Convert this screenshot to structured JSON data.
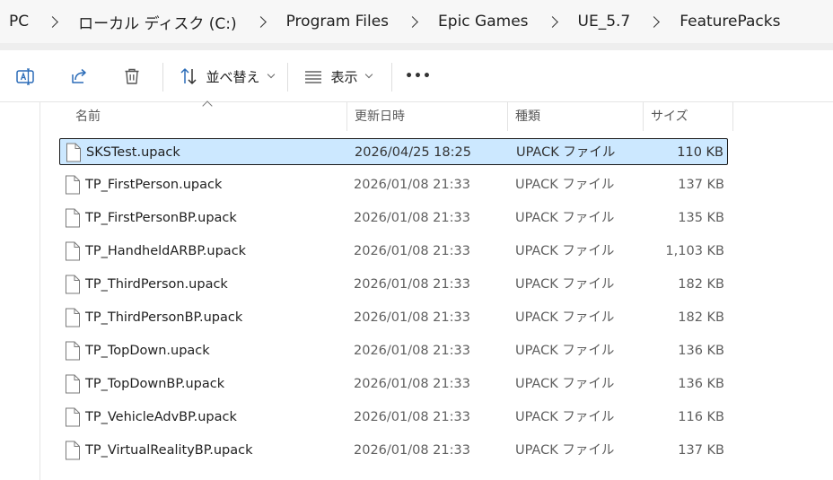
{
  "breadcrumb": [
    "PC",
    "ローカル ディスク (C:)",
    "Program Files",
    "Epic Games",
    "UE_5.7",
    "FeaturePacks"
  ],
  "toolbar": {
    "rename_icon": "rename-icon",
    "share_icon": "share-icon",
    "delete_icon": "trash-icon",
    "sort_label": "並べ替え",
    "view_label": "表示",
    "more_label": "•••"
  },
  "columns": {
    "name": "名前",
    "date": "更新日時",
    "type": "種類",
    "size": "サイズ"
  },
  "files": [
    {
      "name": "SKSTest.upack",
      "date": "2026/04/25 18:25",
      "type": "UPACK ファイル",
      "size": "110 KB",
      "selected": true
    },
    {
      "name": "TP_FirstPerson.upack",
      "date": "2026/01/08 21:33",
      "type": "UPACK ファイル",
      "size": "137 KB"
    },
    {
      "name": "TP_FirstPersonBP.upack",
      "date": "2026/01/08 21:33",
      "type": "UPACK ファイル",
      "size": "135 KB"
    },
    {
      "name": "TP_HandheldARBP.upack",
      "date": "2026/01/08 21:33",
      "type": "UPACK ファイル",
      "size": "1,103 KB"
    },
    {
      "name": "TP_ThirdPerson.upack",
      "date": "2026/01/08 21:33",
      "type": "UPACK ファイル",
      "size": "182 KB"
    },
    {
      "name": "TP_ThirdPersonBP.upack",
      "date": "2026/01/08 21:33",
      "type": "UPACK ファイル",
      "size": "182 KB"
    },
    {
      "name": "TP_TopDown.upack",
      "date": "2026/01/08 21:33",
      "type": "UPACK ファイル",
      "size": "136 KB"
    },
    {
      "name": "TP_TopDownBP.upack",
      "date": "2026/01/08 21:33",
      "type": "UPACK ファイル",
      "size": "136 KB"
    },
    {
      "name": "TP_VehicleAdvBP.upack",
      "date": "2026/01/08 21:33",
      "type": "UPACK ファイル",
      "size": "116 KB"
    },
    {
      "name": "TP_VirtualRealityBP.upack",
      "date": "2026/01/08 21:33",
      "type": "UPACK ファイル",
      "size": "137 KB"
    }
  ],
  "colors": {
    "accent": "#0067c0",
    "selection": "#cce8ff",
    "selection_border": "#1a1a1a"
  }
}
